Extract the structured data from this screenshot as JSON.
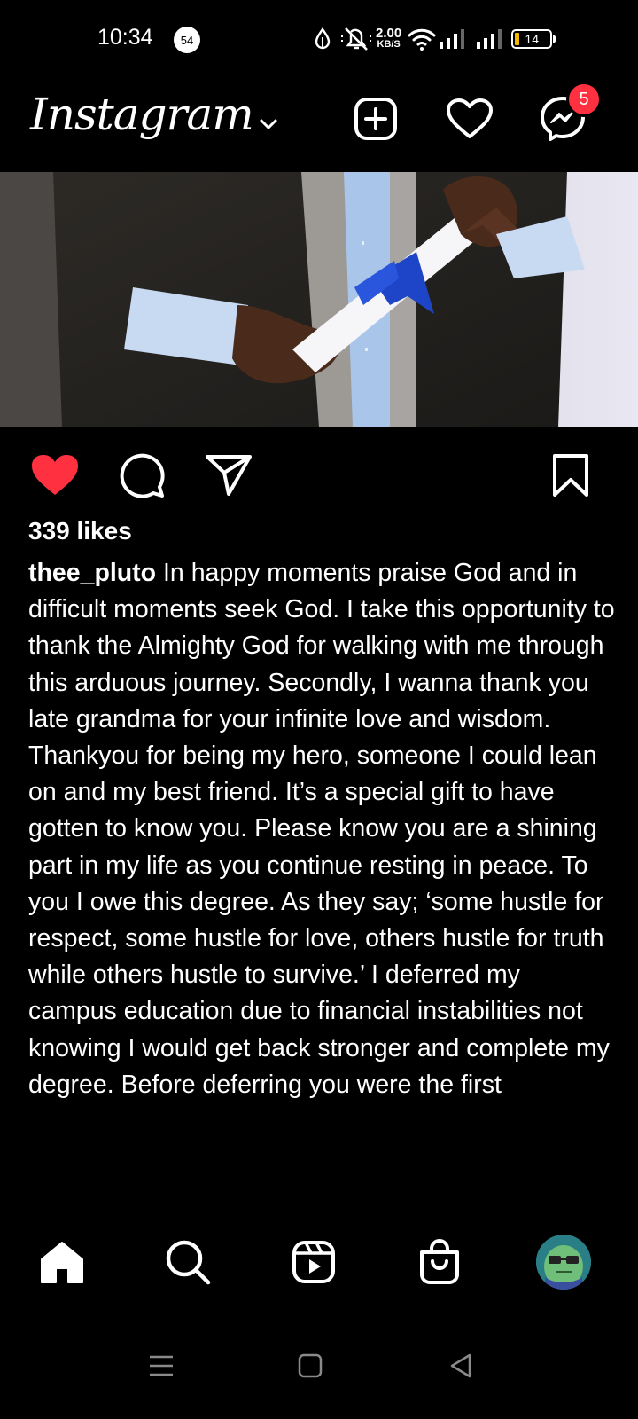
{
  "status_bar": {
    "time": "10:34",
    "notification_count": "54",
    "net_speed_value": "2.00",
    "net_speed_unit": "KB/S",
    "battery": "14"
  },
  "header": {
    "logo_text": "Instagram",
    "dm_badge": "5"
  },
  "post": {
    "likes": "339 likes",
    "username": "thee_pluto",
    "caption": " In happy moments praise God and in difficult moments seek God. I take this opportunity to thank the Almighty God for walking with me through this arduous journey. Secondly, I wanna thank you late grandma for your infinite love and wisdom. Thankyou for being my hero, someone I could lean on and my best friend. It’s a special gift to have gotten to know you. Please know you are a shining part in my life as you continue resting in peace. To you I owe this degree. As they say; ‘some hustle for respect,  some hustle for love, others hustle for truth while others hustle to survive.’ I deferred my campus education due to financial instabilities not knowing I would get back stronger and complete my degree. Before deferring you were the first",
    "liked": true
  },
  "colors": {
    "background": "#000000",
    "like_red": "#ff3040",
    "text": "#ffffff",
    "battery_fill": "#f5b800"
  },
  "icons": {
    "status": [
      "notification-badge",
      "data-saver-icon",
      "mute-icon",
      "wifi-icon",
      "signal-icon",
      "signal-icon-2",
      "battery-icon"
    ],
    "header": [
      "chevron-down-icon",
      "add-post-icon",
      "heart-icon",
      "messenger-icon"
    ],
    "actions": [
      "like-icon",
      "comment-icon",
      "share-icon",
      "bookmark-icon"
    ],
    "bottom_nav": [
      "home-icon",
      "search-icon",
      "reels-icon",
      "shop-icon",
      "profile-avatar"
    ],
    "system_nav": [
      "menu-icon",
      "home-square-icon",
      "back-icon"
    ]
  }
}
